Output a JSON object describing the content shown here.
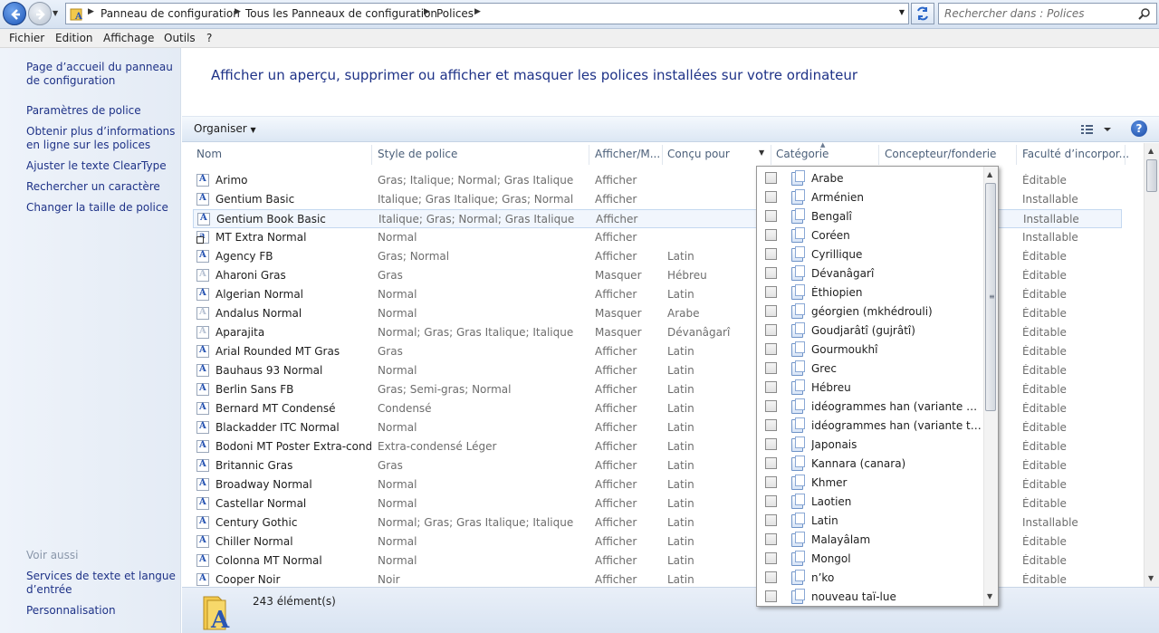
{
  "address": {
    "crumbs": [
      "Panneau de configuration",
      "Tous les Panneaux de configuration",
      "Polices"
    ],
    "search_placeholder": "Rechercher dans : Polices"
  },
  "menu": [
    "Fichier",
    "Edition",
    "Affichage",
    "Outils",
    "?"
  ],
  "left_pane": {
    "tasks": [
      "Page d’accueil du panneau de configuration",
      "Paramètres de police",
      "Obtenir plus d’informations en ligne sur les polices",
      "Ajuster le texte ClearType",
      "Rechercher un caractère",
      "Changer la taille de police"
    ],
    "see_also_title": "Voir aussi",
    "see_also": [
      "Services de texte et langue d’entrée",
      "Personnalisation"
    ]
  },
  "page_title": "Afficher un aperçu, supprimer ou afficher et masquer les polices installées sur votre ordinateur",
  "toolbar": {
    "organize": "Organiser",
    "help": "?"
  },
  "columns": [
    "Nom",
    "Style de police",
    "Afficher/M...",
    "Conçu pour",
    "Catégorie",
    "Concepteur/fonderie",
    "Faculté d’incorpor..."
  ],
  "fonts": [
    {
      "name": "Arimo",
      "style": "Gras; Italique; Normal; Gras Italique",
      "show": "Afficher",
      "for": "",
      "cap": "Éditable",
      "icon": "A",
      "faded": false,
      "link": false
    },
    {
      "name": "Gentium Basic",
      "style": "Italique; Gras Italique; Gras; Normal",
      "show": "Afficher",
      "for": "",
      "cap": "Installable",
      "icon": "A",
      "faded": false,
      "link": false
    },
    {
      "name": "Gentium Book Basic",
      "style": "Italique; Gras; Normal; Gras Italique",
      "show": "Afficher",
      "for": "",
      "cap": "Installable",
      "icon": "A",
      "faded": false,
      "link": false
    },
    {
      "name": "MT Extra Normal",
      "style": "Normal",
      "show": "Afficher",
      "for": "",
      "cap": "Installable",
      "icon": "a",
      "faded": false,
      "link": true
    },
    {
      "name": "Agency FB",
      "style": "Gras; Normal",
      "show": "Afficher",
      "for": "Latin",
      "cap": "Éditable",
      "icon": "A",
      "faded": false,
      "link": false
    },
    {
      "name": "Aharoni Gras",
      "style": "Gras",
      "show": "Masquer",
      "for": "Hébreu",
      "cap": "Éditable",
      "icon": "A",
      "faded": true,
      "link": false
    },
    {
      "name": "Algerian Normal",
      "style": "Normal",
      "show": "Afficher",
      "for": "Latin",
      "cap": "Éditable",
      "icon": "A",
      "faded": false,
      "link": false
    },
    {
      "name": "Andalus Normal",
      "style": "Normal",
      "show": "Masquer",
      "for": "Arabe",
      "cap": "Éditable",
      "icon": "A",
      "faded": true,
      "link": false
    },
    {
      "name": "Aparajita",
      "style": "Normal; Gras; Gras Italique; Italique",
      "show": "Masquer",
      "for": "Dévanâgarî",
      "cap": "Éditable",
      "icon": "A",
      "faded": true,
      "link": false
    },
    {
      "name": "Arial Rounded MT Gras",
      "style": "Gras",
      "show": "Afficher",
      "for": "Latin",
      "cap": "Éditable",
      "icon": "A",
      "faded": false,
      "link": false
    },
    {
      "name": "Bauhaus 93 Normal",
      "style": "Normal",
      "show": "Afficher",
      "for": "Latin",
      "cap": "Éditable",
      "icon": "A",
      "faded": false,
      "link": false
    },
    {
      "name": "Berlin Sans FB",
      "style": "Gras; Semi-gras; Normal",
      "show": "Afficher",
      "for": "Latin",
      "cap": "Éditable",
      "icon": "A",
      "faded": false,
      "link": false
    },
    {
      "name": "Bernard MT Condensé",
      "style": "Condensé",
      "show": "Afficher",
      "for": "Latin",
      "cap": "Éditable",
      "icon": "A",
      "faded": false,
      "link": false
    },
    {
      "name": "Blackadder ITC Normal",
      "style": "Normal",
      "show": "Afficher",
      "for": "Latin",
      "cap": "Éditable",
      "icon": "A",
      "faded": false,
      "link": false
    },
    {
      "name": "Bodoni MT Poster Extra-cond...",
      "style": "Extra-condensé Léger",
      "show": "Afficher",
      "for": "Latin",
      "cap": "Éditable",
      "icon": "A",
      "faded": false,
      "link": false
    },
    {
      "name": "Britannic Gras",
      "style": "Gras",
      "show": "Afficher",
      "for": "Latin",
      "cap": "Éditable",
      "icon": "A",
      "faded": false,
      "link": false
    },
    {
      "name": "Broadway Normal",
      "style": "Normal",
      "show": "Afficher",
      "for": "Latin",
      "cap": "Éditable",
      "icon": "A",
      "faded": false,
      "link": false
    },
    {
      "name": "Castellar Normal",
      "style": "Normal",
      "show": "Afficher",
      "for": "Latin",
      "cap": "Éditable",
      "icon": "A",
      "faded": false,
      "link": false
    },
    {
      "name": "Century Gothic",
      "style": "Normal; Gras; Gras Italique; Italique",
      "show": "Afficher",
      "for": "Latin",
      "cap": "Installable",
      "icon": "A",
      "faded": false,
      "link": false
    },
    {
      "name": "Chiller Normal",
      "style": "Normal",
      "show": "Afficher",
      "for": "Latin",
      "cap": "Éditable",
      "icon": "A",
      "faded": false,
      "link": false
    },
    {
      "name": "Colonna MT Normal",
      "style": "Normal",
      "show": "Afficher",
      "for": "Latin",
      "cap": "Éditable",
      "icon": "A",
      "faded": false,
      "link": false
    },
    {
      "name": "Cooper Noir",
      "style": "Noir",
      "show": "Afficher",
      "for": "Latin",
      "cap": "Éditable",
      "icon": "A",
      "faded": false,
      "link": false
    }
  ],
  "selected_row": 2,
  "status": {
    "count": "243 élément(s)"
  },
  "filter_dropdown": [
    "Arabe",
    "Arménien",
    "Bengalî",
    "Coréen",
    "Cyrillique",
    "Dévanâgarî",
    "Éthiopien",
    "géorgien (mkhédrouli)",
    "Goudjarâtî (gujrâtî)",
    "Gourmoukhî",
    "Grec",
    "Hébreu",
    "idéogrammes han (variante simplifiée)",
    "idéogrammes han (variante traditionnelle)",
    "Japonais",
    "Kannara (canara)",
    "Khmer",
    "Laotien",
    "Latin",
    "Malayâlam",
    "Mongol",
    "n’ko",
    "nouveau taï-lue"
  ]
}
